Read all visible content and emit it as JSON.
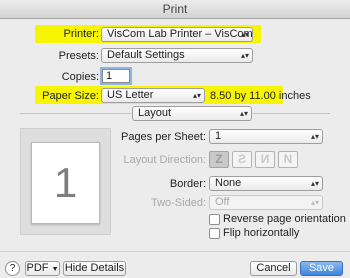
{
  "window": {
    "title": "Print"
  },
  "printer": {
    "label": "Printer:",
    "value": "VisCom Lab Printer – VisCom RIP"
  },
  "presets": {
    "label": "Presets:",
    "value": "Default Settings"
  },
  "copies": {
    "label": "Copies:",
    "value": "1"
  },
  "paper_size": {
    "label": "Paper Size:",
    "value": "US Letter",
    "dimensions": "8.50 by 11.00 inches"
  },
  "section": {
    "value": "Layout"
  },
  "preview": {
    "page_number": "1"
  },
  "layout": {
    "pages_per_sheet_label": "Pages per Sheet:",
    "pages_per_sheet_value": "1",
    "direction_label": "Layout Direction:",
    "border_label": "Border:",
    "border_value": "None",
    "two_sided_label": "Two-Sided:",
    "two_sided_value": "Off",
    "reverse_label": "Reverse page orientation",
    "flip_label": "Flip horizontally"
  },
  "footer": {
    "help": "?",
    "pdf": "PDF",
    "hide_details": "Hide Details",
    "cancel": "Cancel",
    "save": "Save"
  },
  "icons": {
    "arrows": "up-down-arrows-icon",
    "pdf_arrow": "chevron-down-icon"
  },
  "colors": {
    "highlight": "#f7f500",
    "accent": "#3f85de"
  }
}
